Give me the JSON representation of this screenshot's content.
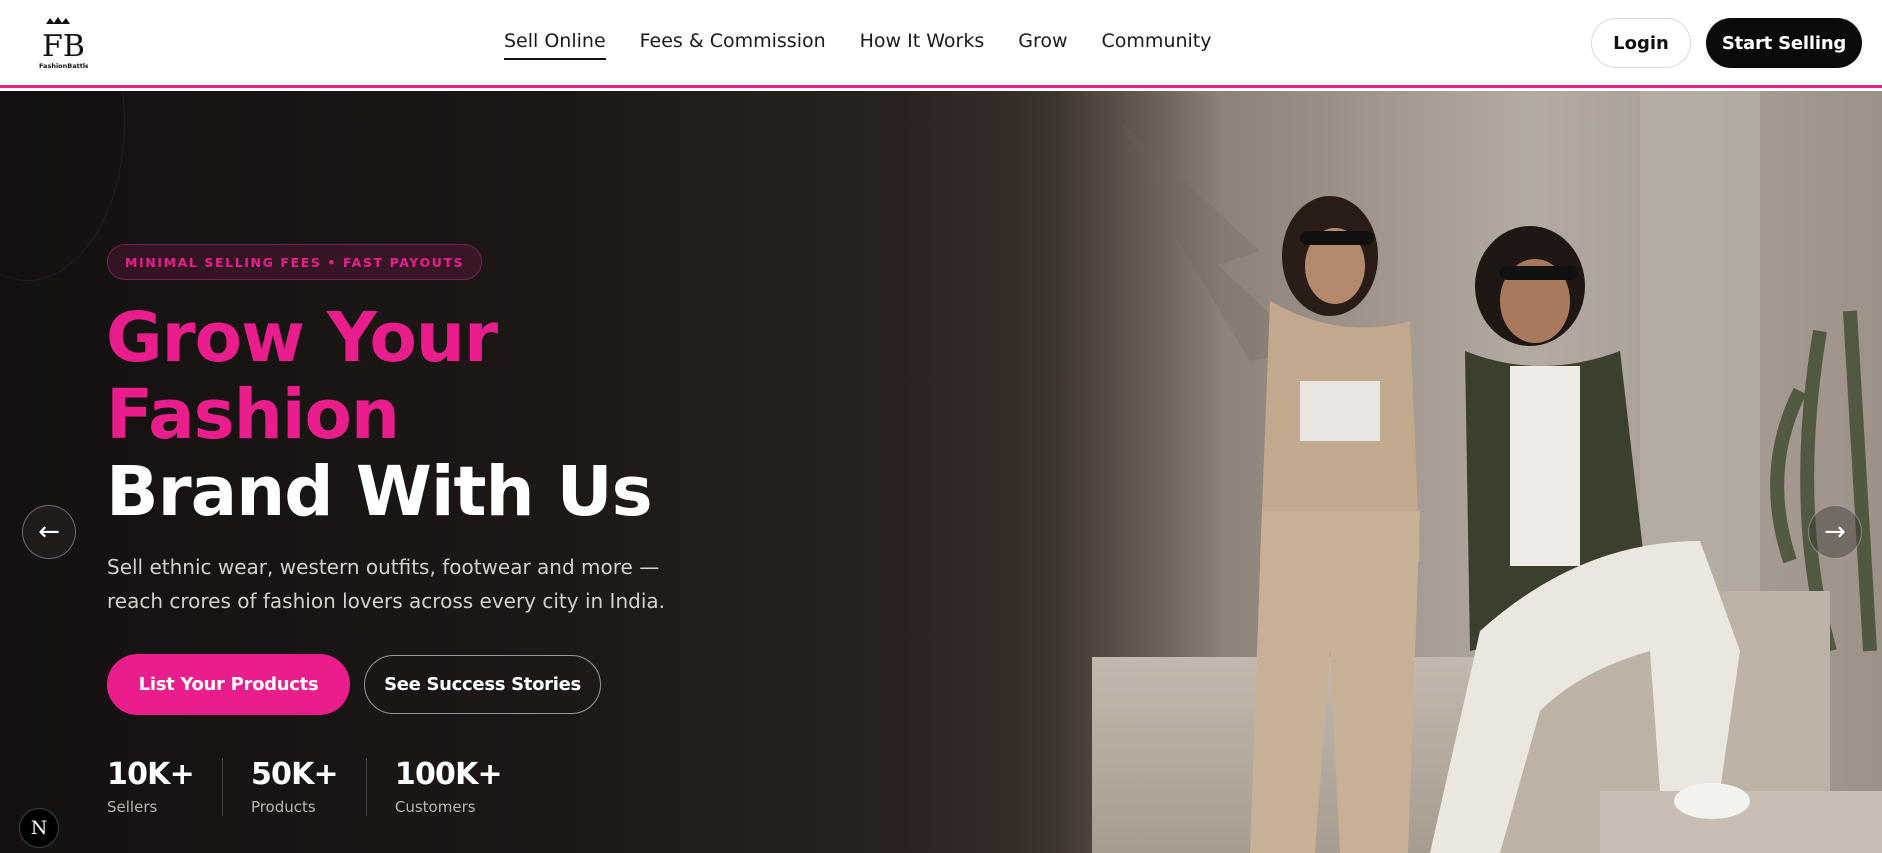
{
  "brand": {
    "logo_letters": "FB",
    "logo_name": "FashionBattle"
  },
  "nav": {
    "items": [
      {
        "label": "Sell Online",
        "active": true
      },
      {
        "label": "Fees & Commission",
        "active": false
      },
      {
        "label": "How It Works",
        "active": false
      },
      {
        "label": "Grow",
        "active": false
      },
      {
        "label": "Community",
        "active": false
      }
    ]
  },
  "header": {
    "login_label": "Login",
    "start_label": "Start Selling"
  },
  "hero": {
    "badge": "MINIMAL SELLING FEES • FAST PAYOUTS",
    "headline_line1": "Grow Your",
    "headline_line2": "Fashion",
    "headline_line3": "Brand With Us",
    "subtext": "Sell ethnic wear, western outfits, footwear and more — reach crores of fashion lovers across every city in India.",
    "primary_cta": "List Your Products",
    "secondary_cta": "See Success Stories",
    "stats": [
      {
        "value": "10K+",
        "label": "Sellers"
      },
      {
        "value": "50K+",
        "label": "Products"
      },
      {
        "value": "100K+",
        "label": "Customers"
      }
    ],
    "prev_arrow": "←",
    "next_arrow": "→"
  },
  "corner_badge": "N",
  "colors": {
    "accent": "#e91e8c",
    "dark": "#0a0a0a"
  }
}
